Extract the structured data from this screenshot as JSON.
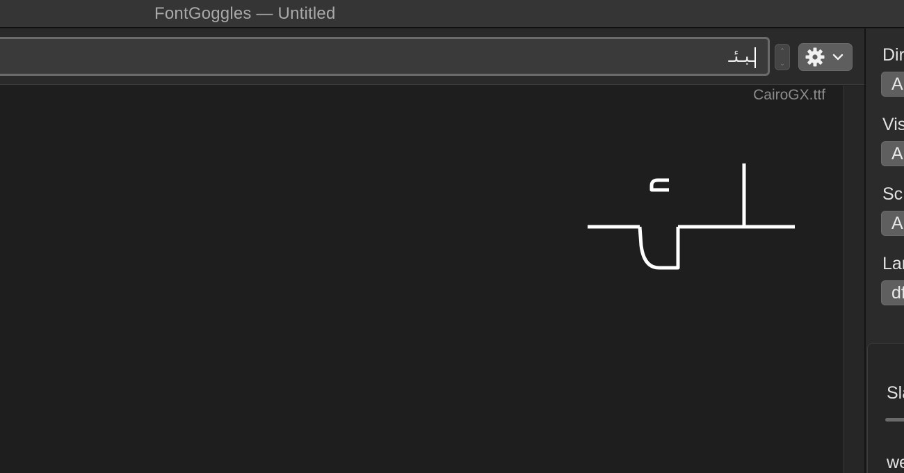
{
  "window": {
    "title": "FontGoggles — Untitled"
  },
  "toolbar": {
    "text_value": "ـبـئـ",
    "stepper_up": "⌃",
    "stepper_down": "⌄"
  },
  "canvas": {
    "font_name": "CairoGX.ttf",
    "glyph_color": "#ffffff"
  },
  "sidebar": {
    "fields": [
      {
        "label": "Dir",
        "value": "Au"
      },
      {
        "label": "Vis",
        "value": "Au"
      },
      {
        "label": "Sc",
        "value": "Au"
      },
      {
        "label": "Lar",
        "value": "df"
      }
    ],
    "slider_label": "Sla",
    "axis_label": "we"
  },
  "colors": {
    "titlebar": "#353535",
    "canvas_bg": "#1e1e1e",
    "toolbar_bg": "#2a2a2a",
    "popup_bg": "#5f5f5f"
  },
  "icons": {
    "gear": "gear-icon",
    "chevron": "chevron-down-icon"
  }
}
